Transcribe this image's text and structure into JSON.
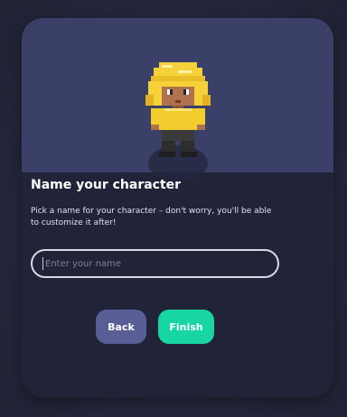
{
  "dialog": {
    "title": "Name your character",
    "description": "Pick a name for your character – don't worry, you'll be able to customize it after!",
    "name_input": {
      "value": "",
      "placeholder": "Enter your name"
    },
    "back_label": "Back",
    "finish_label": "Finish"
  },
  "colors": {
    "preview_background": "#3a4068",
    "modal_background": "#212438",
    "back_button": "#5a5e96",
    "finish_button": "#18d6a3",
    "hair": "#f6d13a",
    "shirt": "#f3cd2e",
    "skin": "#b0714d"
  },
  "icons": {
    "character": "pixel-avatar-icon"
  }
}
